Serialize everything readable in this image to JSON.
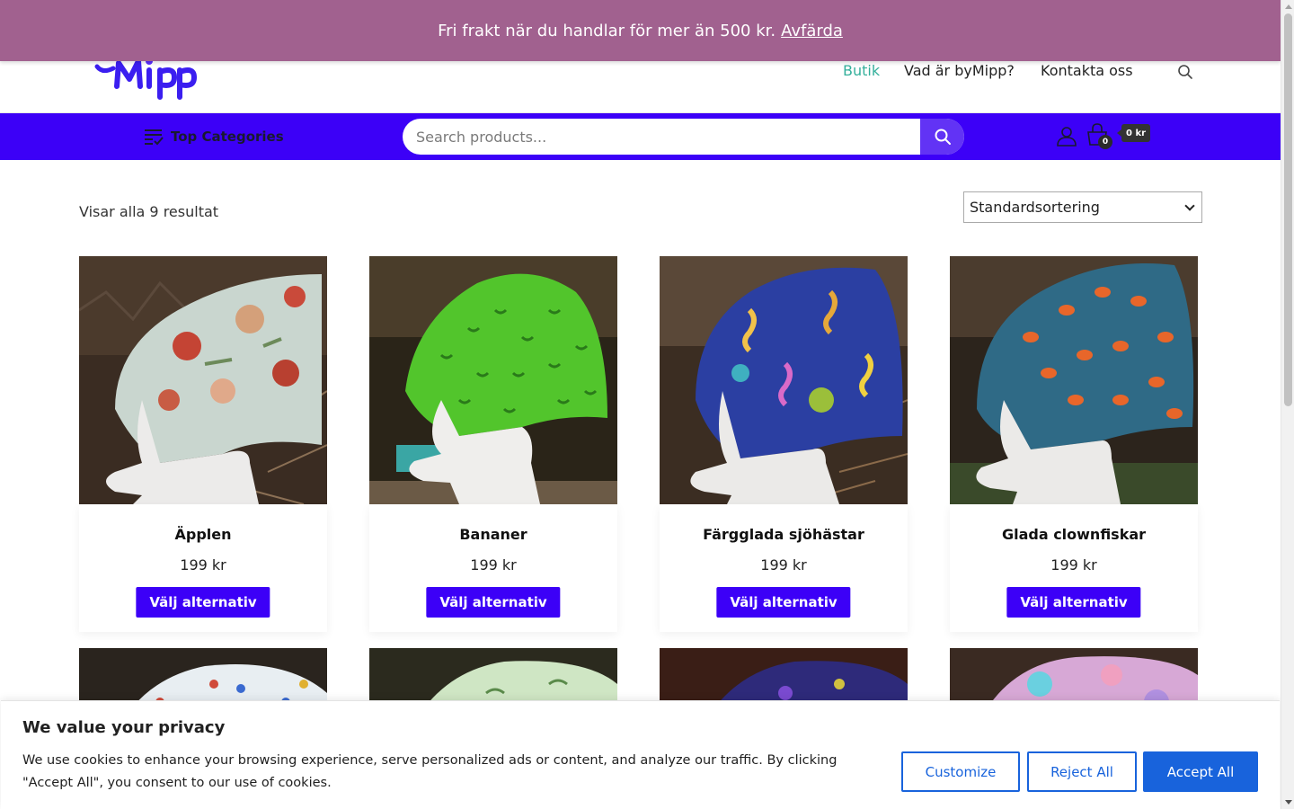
{
  "announcement": {
    "text": "Fri frakt när du handlar för mer än 500 kr.",
    "dismiss": "Avfärda"
  },
  "nav": {
    "items": [
      {
        "label": "Butik",
        "active": true
      },
      {
        "label": "Vad är byMipp?",
        "active": false
      },
      {
        "label": "Kontakta oss",
        "active": false
      }
    ]
  },
  "bar": {
    "top_categories": "Top Categories",
    "search_placeholder": "Search products...",
    "cart_count": "0",
    "cart_total": "0 kr"
  },
  "shop": {
    "result_count": "Visar alla 9 resultat",
    "sort_selected": "Standardsortering"
  },
  "products": [
    {
      "name": "Äpplen",
      "price": "199 kr",
      "cta": "Välj alternativ"
    },
    {
      "name": "Bananer",
      "price": "199 kr",
      "cta": "Välj alternativ"
    },
    {
      "name": "Färgglada sjöhästar",
      "price": "199 kr",
      "cta": "Välj alternativ"
    },
    {
      "name": "Glada clownfiskar",
      "price": "199 kr",
      "cta": "Välj alternativ"
    }
  ],
  "cookie": {
    "title": "We value your privacy",
    "body": "We use cookies to enhance your browsing experience, serve personalized ads or content, and analyze our traffic. By clicking \"Accept All\", you consent to our use of cookies.",
    "customize": "Customize",
    "reject": "Reject All",
    "accept": "Accept All"
  },
  "colors": {
    "announcement_bg": "#a1618f",
    "bar_bg": "#3c00f7",
    "nav_active": "#35b09c",
    "cookie_blue": "#1863dc"
  }
}
